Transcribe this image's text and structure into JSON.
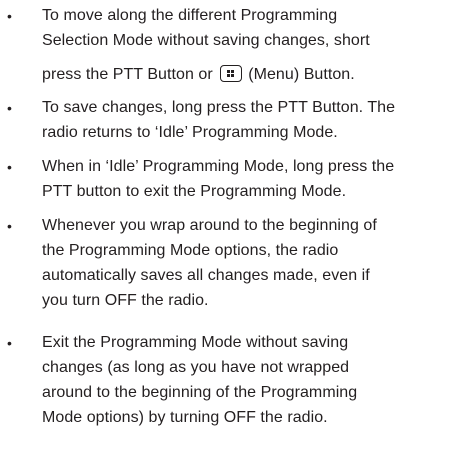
{
  "bullet_symbol": "•",
  "items": [
    {
      "lines": [
        "To move along the different Programming",
        "Selection Mode without saving changes, short"
      ],
      "line3_before": "press the PTT Button or",
      "line3_icon": "menu-button-icon",
      "line3_after": "(Menu) Button."
    },
    {
      "lines": [
        "To save changes, long press the PTT Button. The",
        "radio returns to ‘Idle’ Programming Mode."
      ]
    },
    {
      "lines": [
        "When in ‘Idle’ Programming Mode, long press the",
        "PTT button to exit the Programming Mode."
      ]
    },
    {
      "lines": [
        "Whenever you wrap around to the beginning of",
        "the Programming Mode options, the radio",
        "automatically saves all changes made, even if",
        "you turn OFF the radio."
      ]
    },
    {
      "lines": [
        "Exit the Programming Mode without saving",
        "changes (as long as you have not wrapped",
        "around to the beginning of the Programming",
        "Mode options) by turning OFF the radio."
      ]
    }
  ]
}
